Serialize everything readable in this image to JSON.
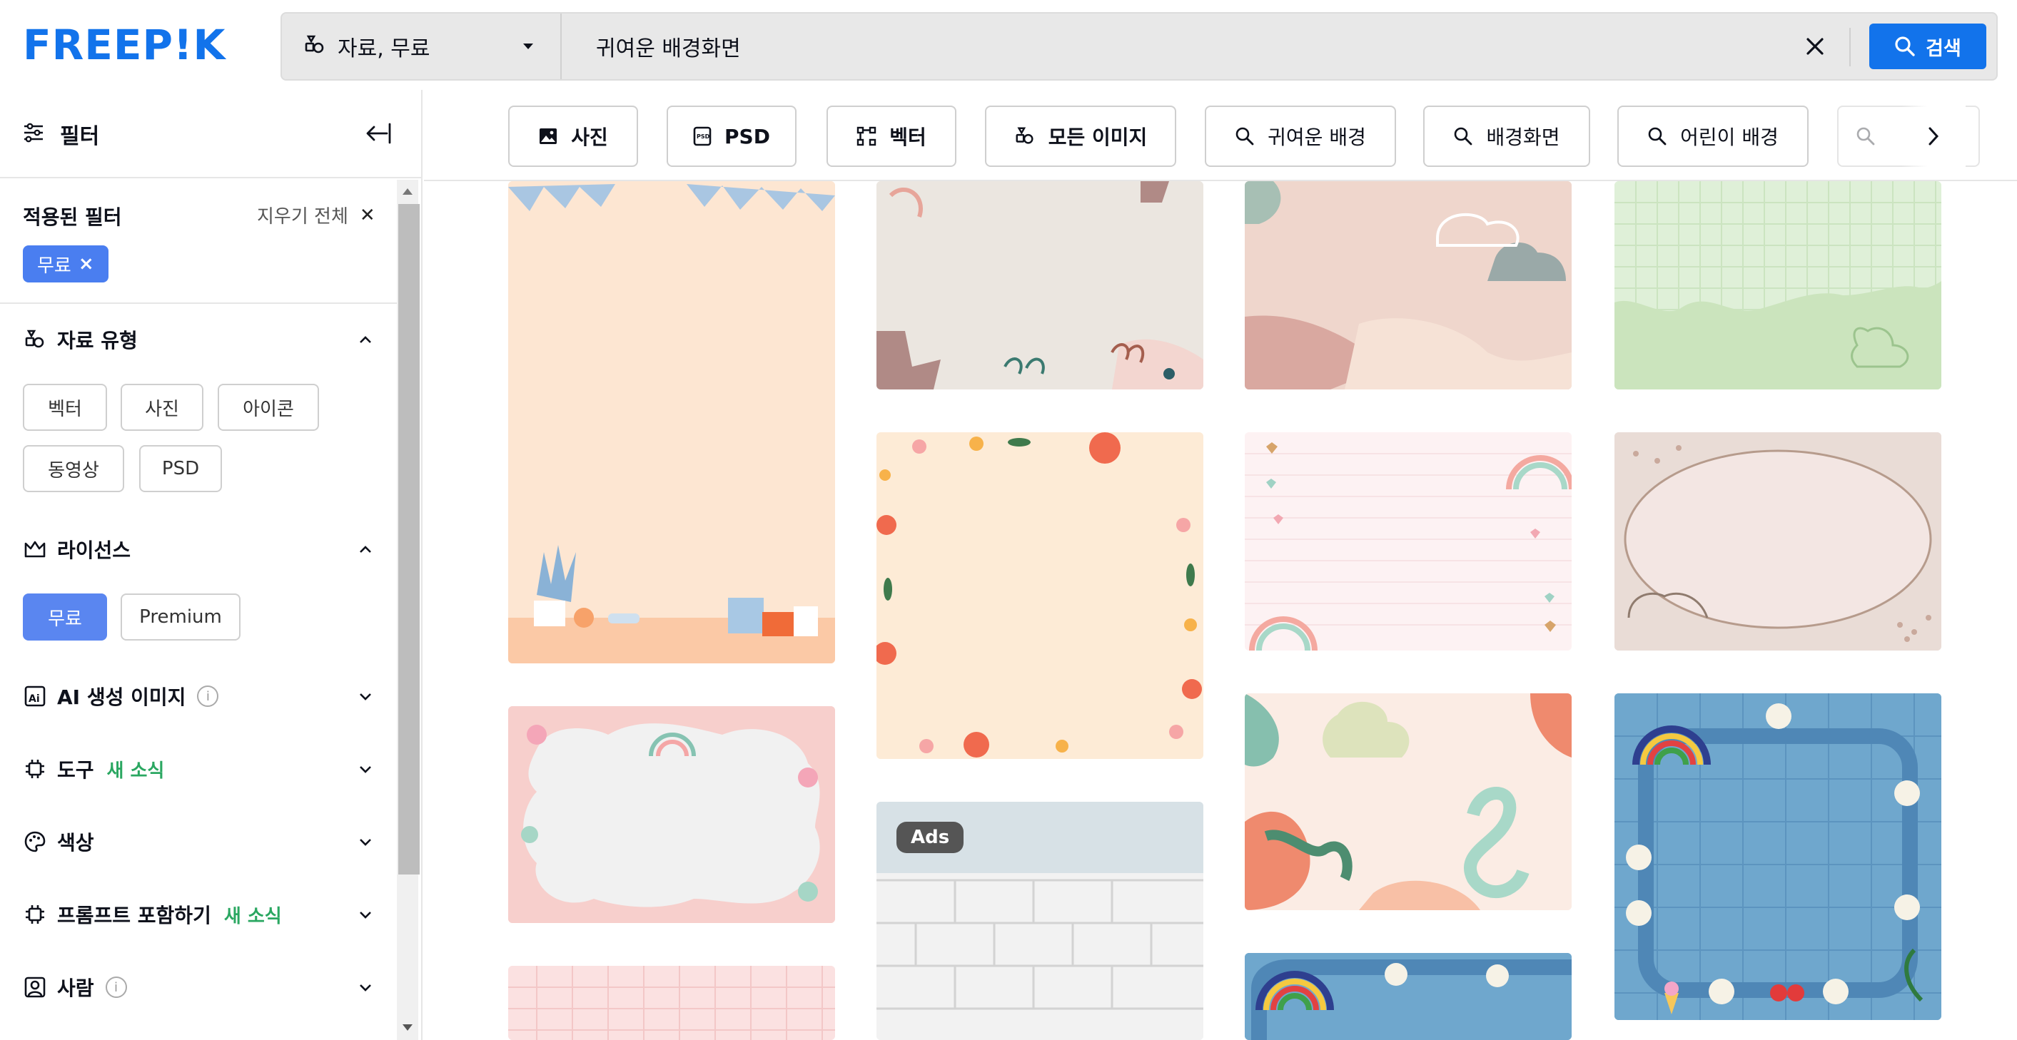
{
  "brand": {
    "logo": "FREEP!K",
    "accent": "#1273eb"
  },
  "search": {
    "type_label": "자료, 무료",
    "query": "귀여운 배경화면",
    "button_label": "검색"
  },
  "sidebar": {
    "title": "필터",
    "applied": {
      "title": "적용된 필터",
      "clear_all": "지우기 전체",
      "chips": [
        "무료"
      ]
    },
    "sections": {
      "asset_type": {
        "title": "자료 유형",
        "options": [
          "벡터",
          "사진",
          "아이콘",
          "동영상",
          "PSD"
        ]
      },
      "license": {
        "title": "라이선스",
        "options": [
          "무료",
          "Premium"
        ],
        "selected": "무료"
      },
      "ai": {
        "title": "AI 생성 이미지"
      },
      "tools": {
        "title": "도구",
        "badge": "새 소식"
      },
      "color": {
        "title": "색상"
      },
      "prompt": {
        "title": "프롬프트 포함하기",
        "badge": "새 소식"
      },
      "people": {
        "title": "사람"
      }
    }
  },
  "tags": [
    {
      "label": "사진",
      "icon": "image-icon"
    },
    {
      "label": "PSD",
      "icon": "psd-icon"
    },
    {
      "label": "벡터",
      "icon": "vector-icon"
    },
    {
      "label": "모든 이미지",
      "icon": "shapes-icon"
    },
    {
      "label": "귀여운 배경",
      "icon": "search-icon"
    },
    {
      "label": "배경화면",
      "icon": "search-icon"
    },
    {
      "label": "어린이 배경",
      "icon": "search-icon"
    }
  ],
  "gallery": {
    "ads_label": "Ads"
  }
}
